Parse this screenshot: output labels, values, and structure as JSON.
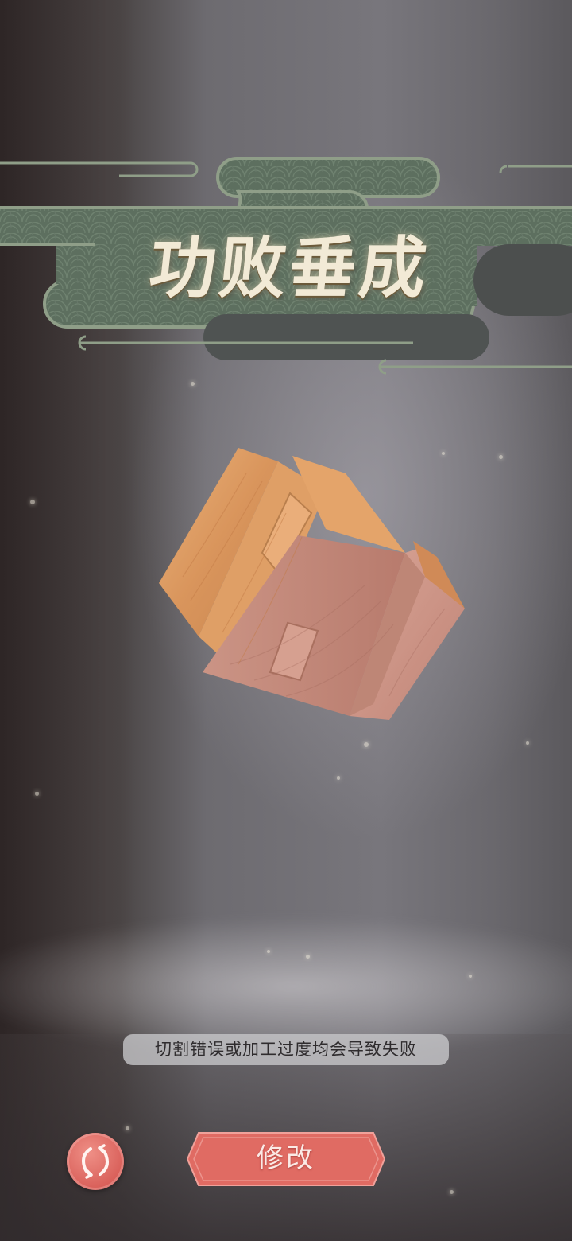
{
  "game": {
    "result_title": "功败垂成",
    "hint_text": "切割错误或加工过度均会导致失败",
    "retry_label": "修改"
  },
  "icons": {
    "restart": "restart-arrows-icon"
  },
  "colors": {
    "banner_green": "#5d6f5f",
    "banner_border": "#8f9e88",
    "button_red": "#e06b63",
    "title_gold": "#f2ead6",
    "wood_light": "#e0a76a",
    "wood_dark": "#c98f80"
  }
}
